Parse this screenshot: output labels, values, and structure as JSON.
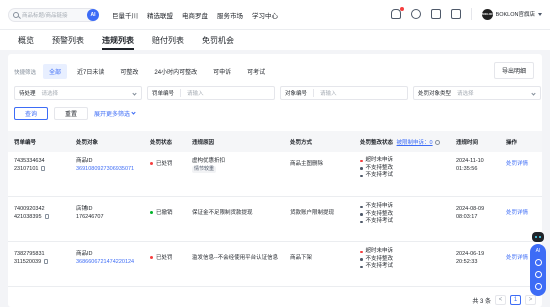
{
  "topbar": {
    "search_placeholder": "商品标题/商品链接",
    "ai_badge": "AI",
    "nav": [
      "巨量千川",
      "精选联盟",
      "电商罗盘",
      "服务市场",
      "学习中心"
    ],
    "account_name": "BOKLON官旗店",
    "avatar_text": "BOKLON"
  },
  "tabs": [
    {
      "label": "概览",
      "active": false
    },
    {
      "label": "预警列表",
      "active": false
    },
    {
      "label": "违规列表",
      "active": true
    },
    {
      "label": "赔付列表",
      "active": false
    },
    {
      "label": "免罚机会",
      "active": false
    }
  ],
  "quick_filter": {
    "label": "快捷筛选",
    "chips": [
      "全部",
      "近7日未读",
      "可整改",
      "24小时内可整改",
      "可申诉",
      "可考试"
    ],
    "export_label": "导出明细"
  },
  "filters": [
    {
      "key": "待处理",
      "placeholder": "请选择"
    },
    {
      "key": "罚单编号",
      "placeholder": "请输入"
    },
    {
      "key": "对象编号",
      "placeholder": "请输入"
    },
    {
      "key": "处罚对象类型",
      "placeholder": "请选择"
    }
  ],
  "actions": {
    "query": "查询",
    "reset": "重置",
    "expand": "展开更多筛选"
  },
  "table": {
    "headers": [
      "罚单编号",
      "处罚对象",
      "处罚状态",
      "违规原因",
      "处罚方式",
      "处罚整改状态",
      "被限制申诉：0",
      "违规时间",
      "操作"
    ],
    "rows": [
      {
        "ticket": [
          "7435334634",
          "23107101"
        ],
        "object_type": "商品ID",
        "object_id": "3691080927306935071",
        "status": "已处罚",
        "status_color": "#f53f3f",
        "reason": "虚构优惠折扣",
        "reason_tag": "情节较重",
        "method": "商品主图删除",
        "rectify": [
          {
            "text": "超时未申诉",
            "red": true
          },
          {
            "text": "不支持整改",
            "red": false
          },
          {
            "text": "不支持考试",
            "red": false
          }
        ],
        "time": [
          "2024-11-10",
          "01:35:56"
        ],
        "op": "处罚详情"
      },
      {
        "ticket": [
          "7400920342",
          "421038395"
        ],
        "object_type": "店铺ID",
        "object_id": "176246707",
        "status": "已撤销",
        "status_color": "#00b42a",
        "reason": "保证金不足限制货款提现",
        "reason_tag": "",
        "method": "货款账户限制提现",
        "rectify": [
          {
            "text": "不支持申诉",
            "red": false
          },
          {
            "text": "不支持整改",
            "red": false
          },
          {
            "text": "不支持考试",
            "red": false
          }
        ],
        "time": [
          "2024-08-09",
          "08:03:17"
        ],
        "op": "处罚详情"
      },
      {
        "ticket": [
          "7382795831",
          "311520039"
        ],
        "object_type": "商品ID",
        "object_id": "3686606721474220124",
        "status": "已处罚",
        "status_color": "#f53f3f",
        "reason": "滥发信息--不会经使用平台认证信息",
        "reason_tag": "",
        "method": "商品下架",
        "rectify": [
          {
            "text": "超时未申诉",
            "red": true
          },
          {
            "text": "不支持整改",
            "red": false
          },
          {
            "text": "不支持考试",
            "red": false
          }
        ],
        "time": [
          "2024-06-19",
          "20:52:33"
        ],
        "op": "处罚详情"
      }
    ]
  },
  "pager": {
    "total": "共 3 条",
    "prev": "<",
    "page": "1",
    "next": ">"
  },
  "float": {
    "label": "AI"
  },
  "colors": {
    "accent": "#3d6cf6",
    "danger": "#f53f3f",
    "success": "#00b42a"
  }
}
